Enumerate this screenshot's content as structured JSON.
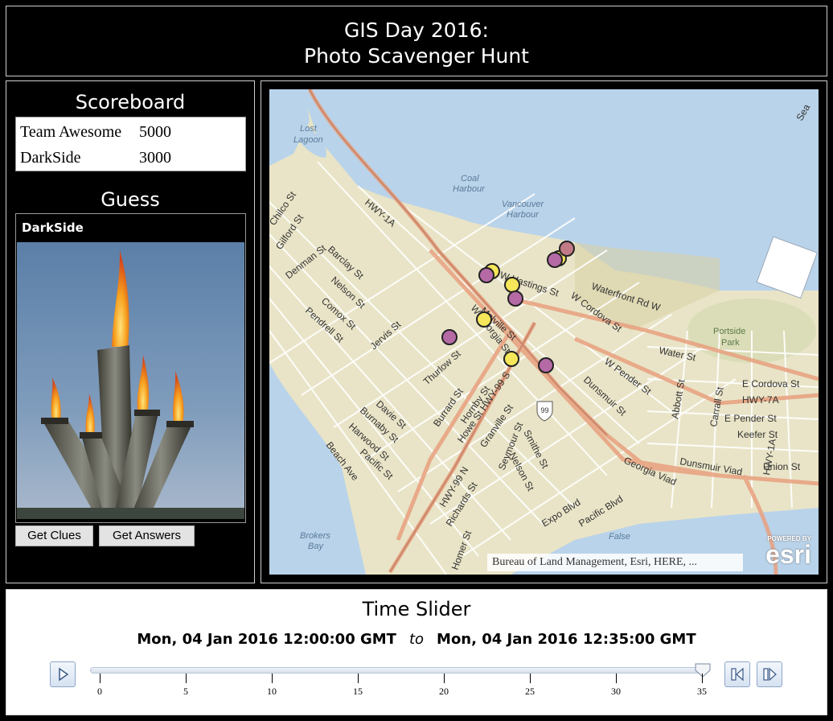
{
  "header": {
    "title_line1": "GIS Day 2016:",
    "title_line2": "Photo Scavenger Hunt"
  },
  "scoreboard": {
    "title": "Scoreboard",
    "rows": [
      {
        "team": "Team Awesome",
        "score": "5000"
      },
      {
        "team": "DarkSide",
        "score": "3000"
      }
    ]
  },
  "guess": {
    "title": "Guess",
    "team": "DarkSide",
    "photo_icon": "olympic-cauldron-photo",
    "buttons": {
      "clues": "Get Clues",
      "answers": "Get Answers"
    }
  },
  "map": {
    "attribution": "Bureau of Land Management, Esri, HERE, ...",
    "logo_powered": "POWERED BY",
    "logo_text": "esri",
    "water_labels": [
      "Lost Lagoon",
      "Coal Harbour",
      "Vancouver Harbour",
      "Portside Park",
      "Brokers Bay",
      "False"
    ],
    "street_labels": [
      "HWY-1A",
      "Chilco St",
      "Gilford St",
      "Denman St",
      "Barclay St",
      "Nelson St",
      "Comox St",
      "Pendrell St",
      "Jervis St",
      "W Hastings St",
      "Melville St",
      "W Georgia St",
      "Thurlow St",
      "Waterfront Rd W",
      "W Cordova St",
      "Water St",
      "W Pender St",
      "Dunsmuir St",
      "Abbott St",
      "Carrall St",
      "E Cordova St",
      "HWY-7A",
      "E Pender St",
      "Keefer St",
      "Union St",
      "Dunsmuir Viad",
      "Georgia Viad",
      "Burrard St",
      "Hornby St",
      "Howe St",
      "HWY-99 S",
      "Granville St",
      "Seymour St",
      "Smithe St",
      "Nelson St",
      "Davie St",
      "Burnaby St",
      "Harwood St",
      "Pacific St",
      "Beach Ave",
      "Richards St",
      "Homer St",
      "Expo Blvd",
      "Pacific Blvd",
      "HWY-99 N",
      "HWY-1A",
      "Sea",
      "99"
    ],
    "colors": {
      "team_awesome": "#f5e65a",
      "darkside": "#b56aa6",
      "mixed": "#c27a86"
    }
  },
  "slider": {
    "title": "Time Slider",
    "start": "Mon, 04 Jan 2016 12:00:00 GMT",
    "to": "to",
    "end": "Mon, 04 Jan 2016 12:35:00 GMT",
    "ticks": [
      "0",
      "5",
      "10",
      "15",
      "20",
      "25",
      "30",
      "35"
    ],
    "value": "35"
  }
}
